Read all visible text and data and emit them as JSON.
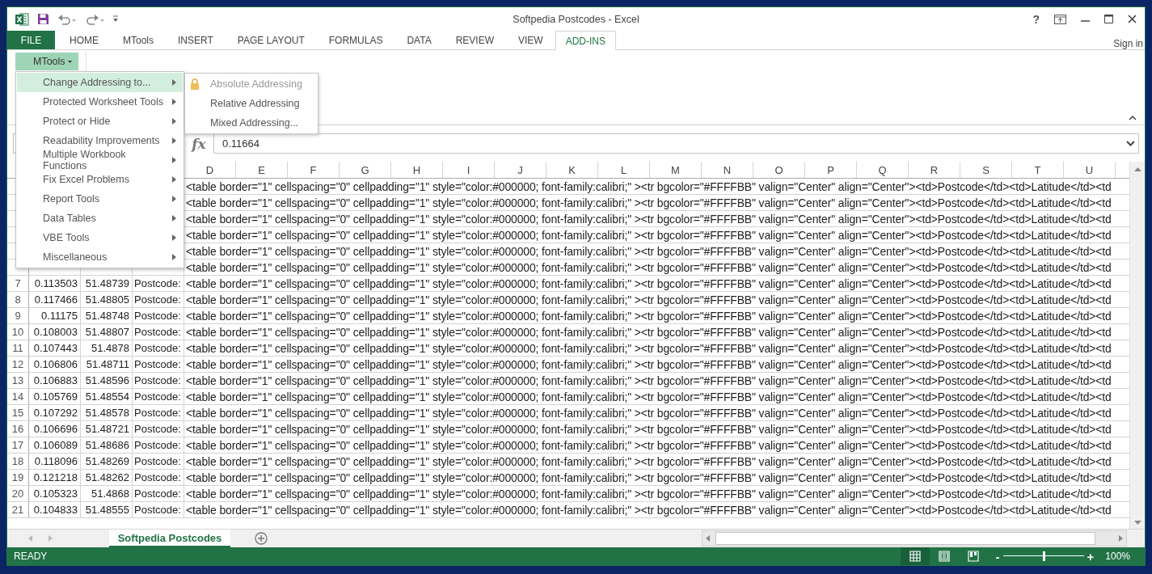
{
  "window": {
    "title": "Softpedia Postcodes - Excel",
    "help": "?"
  },
  "ribbon_tabs": [
    {
      "label": "FILE",
      "kind": "file",
      "selected": false
    },
    {
      "label": "HOME",
      "kind": "tab",
      "selected": false
    },
    {
      "label": "MTools",
      "kind": "tab",
      "selected": false
    },
    {
      "label": "INSERT",
      "kind": "tab",
      "selected": false
    },
    {
      "label": "PAGE LAYOUT",
      "kind": "tab",
      "selected": false
    },
    {
      "label": "FORMULAS",
      "kind": "tab",
      "selected": false
    },
    {
      "label": "DATA",
      "kind": "tab",
      "selected": false
    },
    {
      "label": "REVIEW",
      "kind": "tab",
      "selected": false
    },
    {
      "label": "VIEW",
      "kind": "tab",
      "selected": false
    },
    {
      "label": "ADD-INS",
      "kind": "tab",
      "selected": true
    }
  ],
  "account": {
    "label": "Sign in"
  },
  "ribbon": {
    "button": "MTools"
  },
  "menu": {
    "items": [
      {
        "label": "Change Addressing to...",
        "selected": true
      },
      {
        "label": "Protected Worksheet Tools",
        "selected": false
      },
      {
        "label": "Protect or Hide",
        "selected": false
      },
      {
        "label": "Readability Improvements",
        "selected": false
      },
      {
        "label": "Multiple Workbook Functions",
        "selected": false
      },
      {
        "label": "Fix Excel Problems",
        "selected": false
      },
      {
        "label": "Report Tools",
        "selected": false
      },
      {
        "label": "Data Tables",
        "selected": false
      },
      {
        "label": "VBE Tools",
        "selected": false
      },
      {
        "label": "Miscellaneous",
        "selected": false
      }
    ]
  },
  "submenu": {
    "items": [
      {
        "label": "Absolute Addressing",
        "disabled": true
      },
      {
        "label": "Relative Addressing",
        "disabled": false
      },
      {
        "label": "Mixed Addressing...",
        "disabled": false
      }
    ]
  },
  "formula_bar": {
    "fx_label": "fx",
    "value": "0.11664"
  },
  "sheet": {
    "columns": [
      "D",
      "E",
      "F",
      "G",
      "H",
      "I",
      "J",
      "K",
      "L",
      "M",
      "N",
      "O",
      "P",
      "Q",
      "R",
      "S",
      "T",
      "U"
    ],
    "rows": [
      {
        "d": "<table border=\"1\" cellspacing=\"0\" cellpadding=\"1\" style=\"color:#000000; font-family:calibri;\" ><tr bgcolor=\"#FFFFBB\" valign=\"Center\" align=\"Center\"><td>Postcode</td><td>Latitude</td><td"
      },
      {
        "d": "<table border=\"1\" cellspacing=\"0\" cellpadding=\"1\" style=\"color:#000000; font-family:calibri;\" ><tr bgcolor=\"#FFFFBB\" valign=\"Center\" align=\"Center\"><td>Postcode</td><td>Latitude</td><td"
      },
      {
        "d": "<table border=\"1\" cellspacing=\"0\" cellpadding=\"1\" style=\"color:#000000; font-family:calibri;\" ><tr bgcolor=\"#FFFFBB\" valign=\"Center\" align=\"Center\"><td>Postcode</td><td>Latitude</td><td"
      },
      {
        "d": "<table border=\"1\" cellspacing=\"0\" cellpadding=\"1\" style=\"color:#000000; font-family:calibri;\" ><tr bgcolor=\"#FFFFBB\" valign=\"Center\" align=\"Center\"><td>Postcode</td><td>Latitude</td><td"
      },
      {
        "d": "<table border=\"1\" cellspacing=\"0\" cellpadding=\"1\" style=\"color:#000000; font-family:calibri;\" ><tr bgcolor=\"#FFFFBB\" valign=\"Center\" align=\"Center\"><td>Postcode</td><td>Latitude</td><td"
      },
      {
        "d": "<table border=\"1\" cellspacing=\"0\" cellpadding=\"1\" style=\"color:#000000; font-family:calibri;\" ><tr bgcolor=\"#FFFFBB\" valign=\"Center\" align=\"Center\"><td>Postcode</td><td>Latitude</td><td"
      },
      {
        "num": "7",
        "a": "0.113503",
        "b": "51.48739",
        "c": "Postcode:",
        "d": "<table border=\"1\" cellspacing=\"0\" cellpadding=\"1\" style=\"color:#000000; font-family:calibri;\" ><tr bgcolor=\"#FFFFBB\" valign=\"Center\" align=\"Center\"><td>Postcode</td><td>Latitude</td><td"
      },
      {
        "num": "8",
        "a": "0.117466",
        "b": "51.48805",
        "c": "Postcode:",
        "d": "<table border=\"1\" cellspacing=\"0\" cellpadding=\"1\" style=\"color:#000000; font-family:calibri;\" ><tr bgcolor=\"#FFFFBB\" valign=\"Center\" align=\"Center\"><td>Postcode</td><td>Latitude</td><td"
      },
      {
        "num": "9",
        "a": "0.11175",
        "b": "51.48748",
        "c": "Postcode:",
        "d": "<table border=\"1\" cellspacing=\"0\" cellpadding=\"1\" style=\"color:#000000; font-family:calibri;\" ><tr bgcolor=\"#FFFFBB\" valign=\"Center\" align=\"Center\"><td>Postcode</td><td>Latitude</td><td"
      },
      {
        "num": "10",
        "a": "0.108003",
        "b": "51.48807",
        "c": "Postcode:",
        "d": "<table border=\"1\" cellspacing=\"0\" cellpadding=\"1\" style=\"color:#000000; font-family:calibri;\" ><tr bgcolor=\"#FFFFBB\" valign=\"Center\" align=\"Center\"><td>Postcode</td><td>Latitude</td><td"
      },
      {
        "num": "11",
        "a": "0.107443",
        "b": "51.4878",
        "c": "Postcode:",
        "d": "<table border=\"1\" cellspacing=\"0\" cellpadding=\"1\" style=\"color:#000000; font-family:calibri;\" ><tr bgcolor=\"#FFFFBB\" valign=\"Center\" align=\"Center\"><td>Postcode</td><td>Latitude</td><td"
      },
      {
        "num": "12",
        "a": "0.106806",
        "b": "51.48711",
        "c": "Postcode:",
        "d": "<table border=\"1\" cellspacing=\"0\" cellpadding=\"1\" style=\"color:#000000; font-family:calibri;\" ><tr bgcolor=\"#FFFFBB\" valign=\"Center\" align=\"Center\"><td>Postcode</td><td>Latitude</td><td"
      },
      {
        "num": "13",
        "a": "0.106883",
        "b": "51.48596",
        "c": "Postcode:",
        "d": "<table border=\"1\" cellspacing=\"0\" cellpadding=\"1\" style=\"color:#000000; font-family:calibri;\" ><tr bgcolor=\"#FFFFBB\" valign=\"Center\" align=\"Center\"><td>Postcode</td><td>Latitude</td><td"
      },
      {
        "num": "14",
        "a": "0.105769",
        "b": "51.48554",
        "c": "Postcode:",
        "d": "<table border=\"1\" cellspacing=\"0\" cellpadding=\"1\" style=\"color:#000000; font-family:calibri;\" ><tr bgcolor=\"#FFFFBB\" valign=\"Center\" align=\"Center\"><td>Postcode</td><td>Latitude</td><td"
      },
      {
        "num": "15",
        "a": "0.107292",
        "b": "51.48578",
        "c": "Postcode:",
        "d": "<table border=\"1\" cellspacing=\"0\" cellpadding=\"1\" style=\"color:#000000; font-family:calibri;\" ><tr bgcolor=\"#FFFFBB\" valign=\"Center\" align=\"Center\"><td>Postcode</td><td>Latitude</td><td"
      },
      {
        "num": "16",
        "a": "0.106696",
        "b": "51.48721",
        "c": "Postcode:",
        "d": "<table border=\"1\" cellspacing=\"0\" cellpadding=\"1\" style=\"color:#000000; font-family:calibri;\" ><tr bgcolor=\"#FFFFBB\" valign=\"Center\" align=\"Center\"><td>Postcode</td><td>Latitude</td><td"
      },
      {
        "num": "17",
        "a": "0.106089",
        "b": "51.48686",
        "c": "Postcode:",
        "d": "<table border=\"1\" cellspacing=\"0\" cellpadding=\"1\" style=\"color:#000000; font-family:calibri;\" ><tr bgcolor=\"#FFFFBB\" valign=\"Center\" align=\"Center\"><td>Postcode</td><td>Latitude</td><td"
      },
      {
        "num": "18",
        "a": "0.118096",
        "b": "51.48269",
        "c": "Postcode:",
        "d": "<table border=\"1\" cellspacing=\"0\" cellpadding=\"1\" style=\"color:#000000; font-family:calibri;\" ><tr bgcolor=\"#FFFFBB\" valign=\"Center\" align=\"Center\"><td>Postcode</td><td>Latitude</td><td"
      },
      {
        "num": "19",
        "a": "0.121218",
        "b": "51.48262",
        "c": "Postcode:",
        "d": "<table border=\"1\" cellspacing=\"0\" cellpadding=\"1\" style=\"color:#000000; font-family:calibri;\" ><tr bgcolor=\"#FFFFBB\" valign=\"Center\" align=\"Center\"><td>Postcode</td><td>Latitude</td><td"
      },
      {
        "num": "20",
        "a": "0.105323",
        "b": "51.4868",
        "c": "Postcode:",
        "d": "<table border=\"1\" cellspacing=\"0\" cellpadding=\"1\" style=\"color:#000000; font-family:calibri;\" ><tr bgcolor=\"#FFFFBB\" valign=\"Center\" align=\"Center\"><td>Postcode</td><td>Latitude</td><td"
      },
      {
        "num": "21",
        "a": "0.104833",
        "b": "51.48555",
        "c": "Postcode:",
        "d": "<table border=\"1\" cellspacing=\"0\" cellpadding=\"1\" style=\"color:#000000; font-family:calibri;\" ><tr bgcolor=\"#FFFFBB\" valign=\"Center\" align=\"Center\"><td>Postcode</td><td>Latitude</td><td"
      }
    ]
  },
  "sheet_tabs": [
    {
      "label": "Softpedia Postcodes",
      "selected": true
    }
  ],
  "status_bar": {
    "status": "READY",
    "views": [
      {
        "kind": "normal",
        "selected": true
      },
      {
        "kind": "page-layout",
        "selected": false
      },
      {
        "kind": "page-break",
        "selected": false
      }
    ],
    "zoom_out": "-",
    "zoom_in": "+",
    "zoom": {
      "level": 0.5,
      "reading": "100%"
    }
  }
}
